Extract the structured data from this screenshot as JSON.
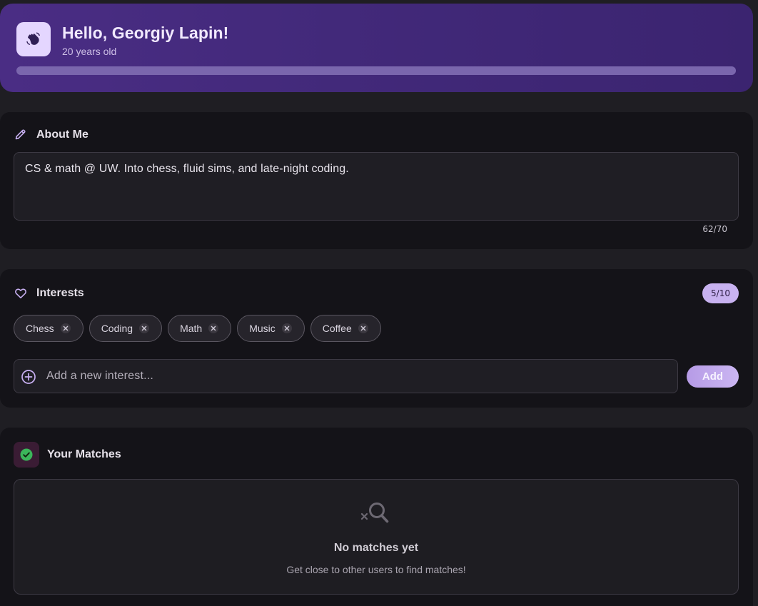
{
  "header": {
    "icon": "waving-hand-icon",
    "greeting": "Hello, Georgiy Lapin!",
    "subtitle": "20 years old",
    "progress": 1.0,
    "accent_color": "#4a2d84"
  },
  "about": {
    "icon": "pencil-icon",
    "title": "About Me",
    "text": "CS & math @ UW. Into chess, fluid sims, and late-night coding.",
    "counter": "62/70"
  },
  "interests": {
    "icon": "heart-icon",
    "title": "Interests",
    "count": "5/10",
    "chips": [
      {
        "label": "Chess"
      },
      {
        "label": "Coding"
      },
      {
        "label": "Math"
      },
      {
        "label": "Music"
      },
      {
        "label": "Coffee"
      }
    ],
    "input_placeholder": "Add a new interest...",
    "add_label": "Add",
    "add_icon": "plus-circle-icon"
  },
  "matches": {
    "icon": "check-circle-icon",
    "title": "Your Matches",
    "empty_icon": "search-off-icon",
    "empty_title": "No matches yet",
    "empty_subtitle": "Get close to other users to find matches!"
  }
}
